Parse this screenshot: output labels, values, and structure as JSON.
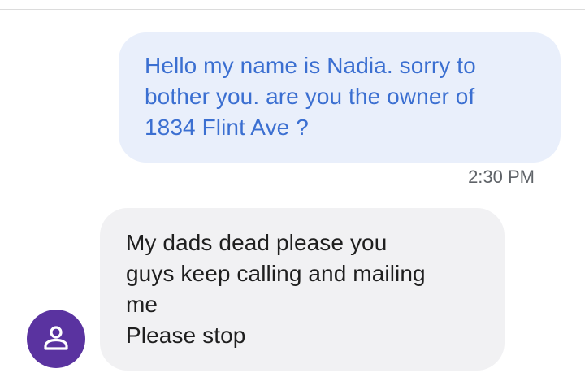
{
  "conversation": {
    "outgoing": {
      "text": "Hello my name is Nadia. sorry to\nbother you. are you the owner of\n1834 Flint Ave ?",
      "time": "2:30 PM"
    },
    "incoming": {
      "text": "My dads dead please you\nguys keep calling and mailing\nme\nPlease stop"
    }
  },
  "avatar": {
    "icon": "person-icon",
    "color": "#5a33a0"
  },
  "colors": {
    "outgoing_bubble": "#e9effb",
    "outgoing_text": "#3b6fd1",
    "incoming_bubble": "#f1f1f3",
    "incoming_text": "#1f1f1f"
  }
}
